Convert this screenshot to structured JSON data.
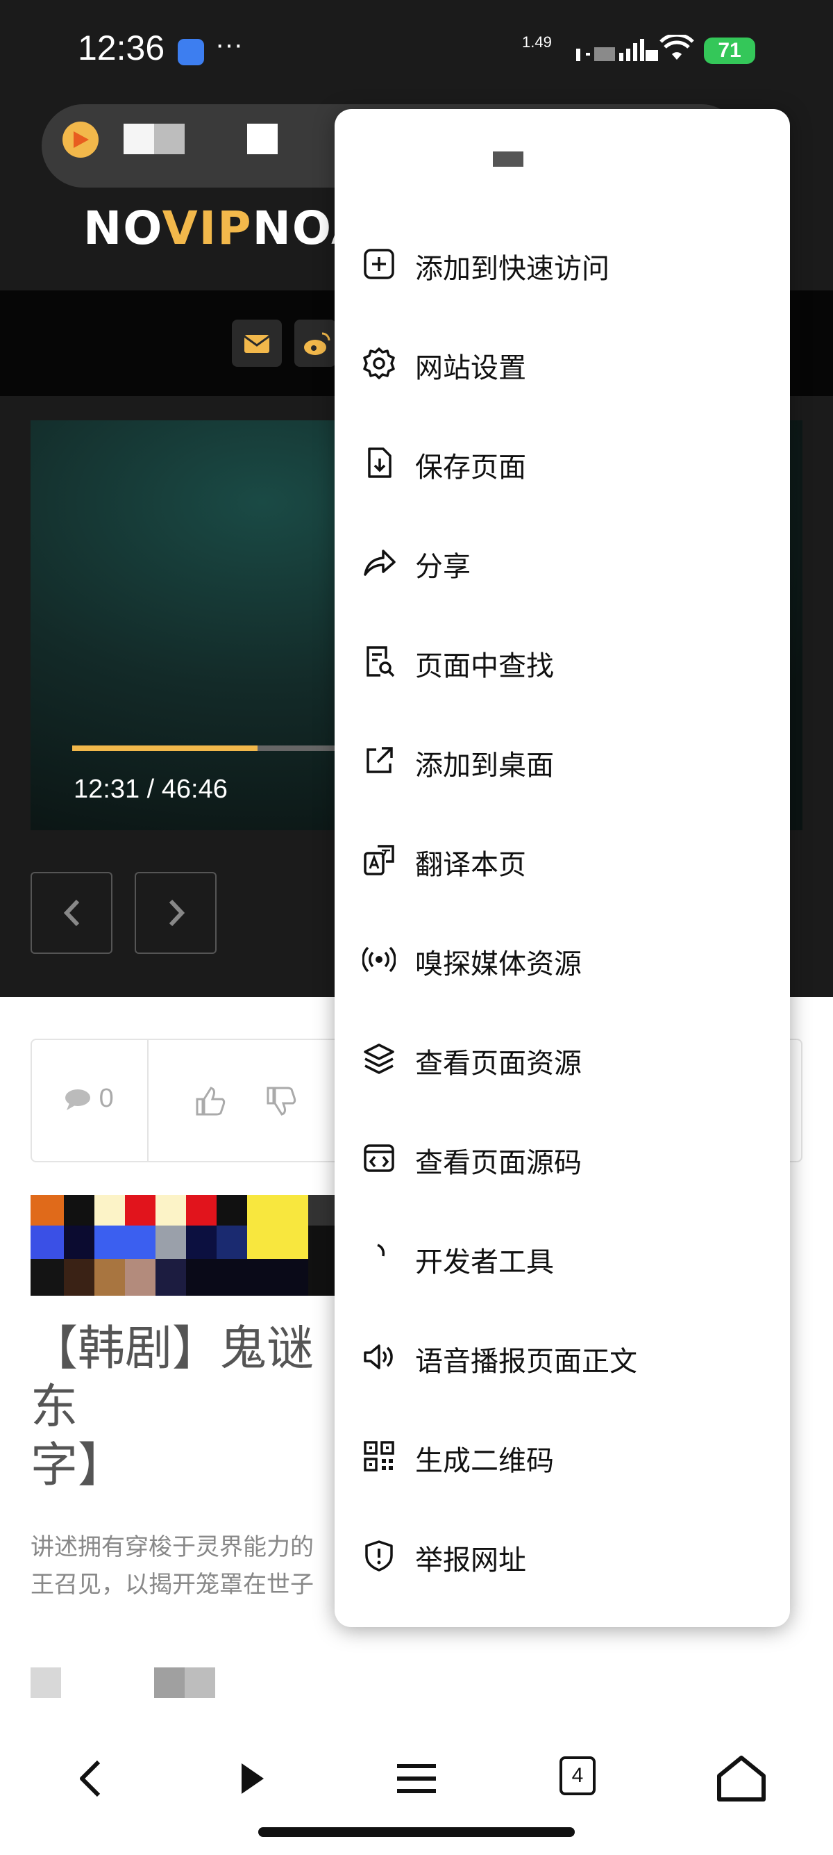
{
  "status_bar": {
    "time": "12:36",
    "dots": "···",
    "net_speed": "1.49",
    "battery": "71"
  },
  "site": {
    "logo_white_1": "NO",
    "logo_yellow": "VIP",
    "logo_white_2": "NOAI"
  },
  "video": {
    "time_display": "12:31 / 46:46",
    "progress": 0.267
  },
  "stats": {
    "comment_count": "0"
  },
  "article": {
    "title": "【韩剧】鬼谜东",
    "title_line2": "字】",
    "description": "讲述拥有穿梭于灵界能力的",
    "description_line2": "王召见，以揭开笼罩在世子"
  },
  "menu": {
    "items": [
      {
        "label": "添加到快速访问",
        "icon": "plus-square-icon"
      },
      {
        "label": "网站设置",
        "icon": "gear-icon"
      },
      {
        "label": "保存页面",
        "icon": "file-download-icon"
      },
      {
        "label": "分享",
        "icon": "share-arrow-icon"
      },
      {
        "label": "页面中查找",
        "icon": "find-in-page-icon"
      },
      {
        "label": "添加到桌面",
        "icon": "external-link-icon"
      },
      {
        "label": "翻译本页",
        "icon": "translate-icon"
      },
      {
        "label": "嗅探媒体资源",
        "icon": "broadcast-icon"
      },
      {
        "label": "查看页面资源",
        "icon": "layers-icon"
      },
      {
        "label": "查看页面源码",
        "icon": "code-window-icon"
      },
      {
        "label": "开发者工具",
        "icon": "developer-tools-icon"
      },
      {
        "label": "语音播报页面正文",
        "icon": "speaker-icon"
      },
      {
        "label": "生成二维码",
        "icon": "qr-code-icon"
      },
      {
        "label": "举报网址",
        "icon": "shield-alert-icon"
      }
    ]
  },
  "bottom_bar": {
    "tab_count": "4"
  },
  "colors": {
    "accent_yellow": "#f2b84b",
    "battery_green": "#34c759",
    "dark_background": "#1b1b1b"
  }
}
